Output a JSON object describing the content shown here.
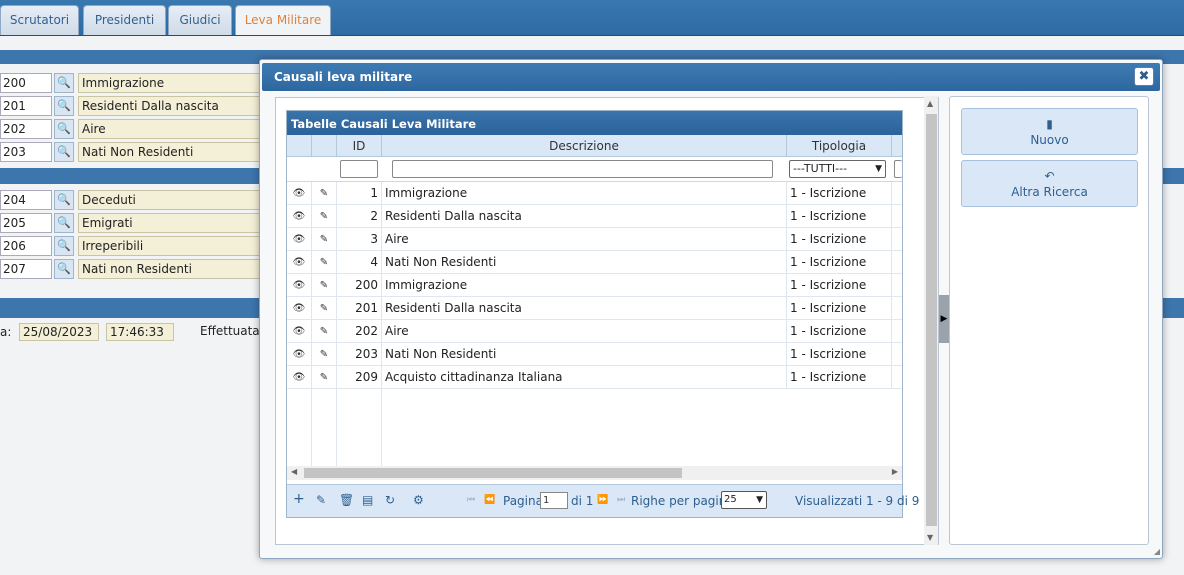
{
  "tabs": [
    {
      "label": "Scrutatori",
      "active": false
    },
    {
      "label": "Presidenti",
      "active": false
    },
    {
      "label": "Giudici",
      "active": false
    },
    {
      "label": "Leva Militare",
      "active": true
    }
  ],
  "background": {
    "group1": [
      {
        "code": "200",
        "desc": "Immigrazione"
      },
      {
        "code": "201",
        "desc": "Residenti Dalla nascita"
      },
      {
        "code": "202",
        "desc": "Aire"
      },
      {
        "code": "203",
        "desc": "Nati Non Residenti"
      }
    ],
    "group2": [
      {
        "code": "204",
        "desc": "Deceduti"
      },
      {
        "code": "205",
        "desc": "Emigrati"
      },
      {
        "code": "206",
        "desc": "Irreperibili"
      },
      {
        "code": "207",
        "desc": "Nati non Residenti"
      }
    ],
    "date_label_fragment": "a:",
    "date": "25/08/2023",
    "time": "17:46:33",
    "effettuata_label": "Effettuata"
  },
  "dialog": {
    "title": "Causali leva militare",
    "close_glyph": "✖",
    "grid": {
      "caption": "Tabelle Causali Leva Militare",
      "columns": {
        "id": "ID",
        "descrizione": "Descrizione",
        "tipologia": "Tipologia"
      },
      "filter_tipologia": "---TUTTI---",
      "rows": [
        {
          "id": "1",
          "descrizione": "Immigrazione",
          "tipologia": "1 - Iscrizione"
        },
        {
          "id": "2",
          "descrizione": "Residenti Dalla nascita",
          "tipologia": "1 - Iscrizione"
        },
        {
          "id": "3",
          "descrizione": "Aire",
          "tipologia": "1 - Iscrizione"
        },
        {
          "id": "4",
          "descrizione": "Nati Non Residenti",
          "tipologia": "1 - Iscrizione"
        },
        {
          "id": "200",
          "descrizione": "Immigrazione",
          "tipologia": "1 - Iscrizione"
        },
        {
          "id": "201",
          "descrizione": "Residenti Dalla nascita",
          "tipologia": "1 - Iscrizione"
        },
        {
          "id": "202",
          "descrizione": "Aire",
          "tipologia": "1 - Iscrizione"
        },
        {
          "id": "203",
          "descrizione": "Nati Non Residenti",
          "tipologia": "1 - Iscrizione"
        },
        {
          "id": "209",
          "descrizione": "Acquisto cittadinanza Italiana",
          "tipologia": "1 - Iscrizione"
        }
      ],
      "pager": {
        "pagina_label": "Pagina",
        "page_value": "1",
        "of_label": "di 1",
        "rows_per_page_label": "Righe per pagina:",
        "rows_per_page_value": "25",
        "summary": "Visualizzati 1 - 9 di 9"
      }
    },
    "actions": {
      "nuovo_label": "Nuovo",
      "altra_ricerca_label": "Altra Ricerca"
    }
  }
}
